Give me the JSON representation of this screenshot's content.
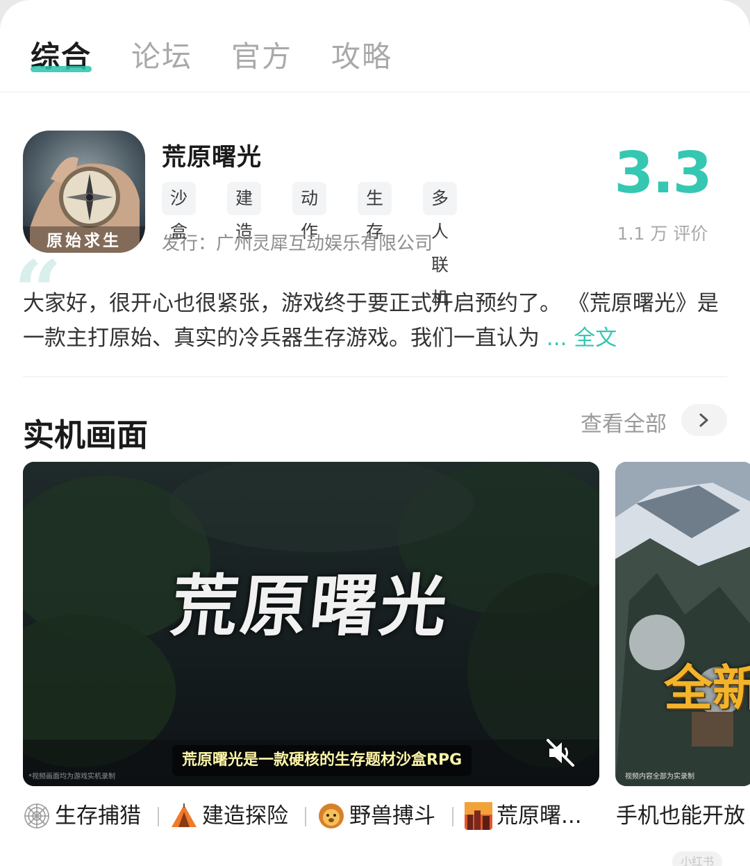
{
  "tabs": [
    {
      "label": "综合",
      "active": true
    },
    {
      "label": "论坛",
      "active": false
    },
    {
      "label": "官方",
      "active": false
    },
    {
      "label": "攻略",
      "active": false
    }
  ],
  "game": {
    "icon_label": "原始求生",
    "title": "荒原曙光",
    "tags": [
      "沙盒",
      "建造",
      "动作",
      "生存",
      "多人联机"
    ],
    "publisher": "发行：广州灵犀互动娱乐有限公司",
    "rating": "3.3",
    "review_count": "1.1 万 评价"
  },
  "description": {
    "text": "大家好，很开心也很紧张，游戏终于要正式开启预约了。 《荒原曙光》是一款主打原始、真实的冷兵器生存游戏。我们一直认为",
    "ellipsis": "...",
    "more_label": "全文"
  },
  "screens_section": {
    "title": "实机画面",
    "view_all_label": "查看全部",
    "shot1": {
      "hero_text": "荒原曙光",
      "subtitle": "荒原曙光是一款硬核的生存题材沙盒RPG",
      "disclaimer": "*视频画面均为游戏实机录制"
    },
    "shot2": {
      "overlay_text": "全新",
      "disclaimer": "视频内容全部为实录制"
    }
  },
  "captions": [
    {
      "icon": "spider-web-icon",
      "label": "生存捕猎"
    },
    {
      "icon": "tent-icon",
      "label": "建造探险"
    },
    {
      "icon": "lion-icon",
      "label": "野兽搏斗"
    },
    {
      "icon": "city-sunset-icon",
      "label": "荒原曙..."
    }
  ],
  "caption2": "手机也能开放",
  "watermark": "小红书",
  "colors": {
    "accent": "#35c7b2",
    "tab_underline": "#2bc2ac"
  }
}
